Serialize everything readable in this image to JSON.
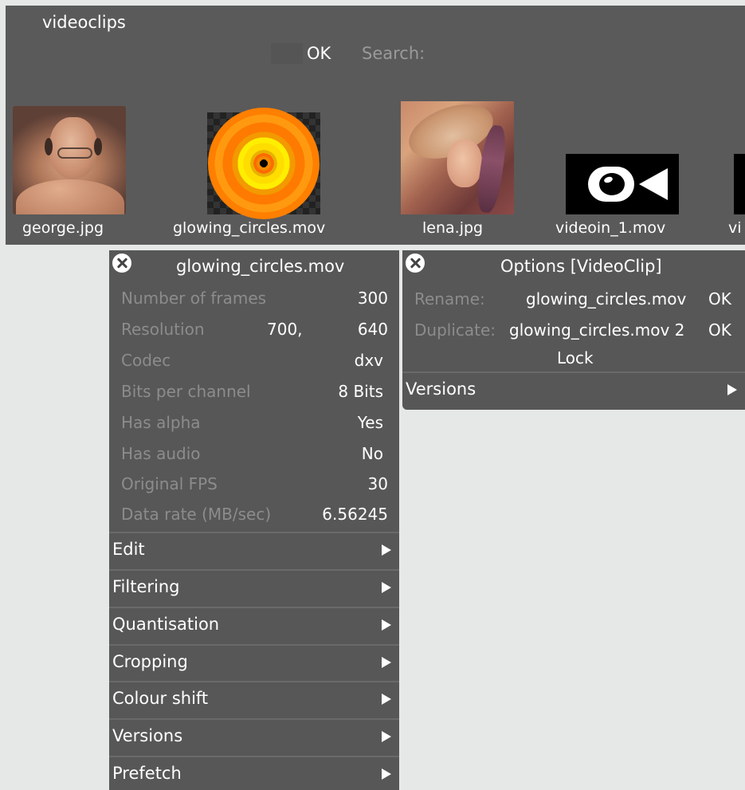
{
  "browser": {
    "title": "videoclips",
    "ok_label": "OK",
    "search_label": "Search:",
    "thumbnails": [
      {
        "label": "george.jpg"
      },
      {
        "label": "glowing_circles.mov"
      },
      {
        "label": "lena.jpg"
      },
      {
        "label": "videoin_1.mov"
      },
      {
        "label": "vi"
      }
    ]
  },
  "clip_panel": {
    "title": "glowing_circles.mov",
    "properties": [
      {
        "label": "Number of frames",
        "value": "300"
      },
      {
        "label": "Resolution",
        "value_a": "700,",
        "value": "640"
      },
      {
        "label": "Codec",
        "value": "dxv"
      },
      {
        "label": "Bits per channel",
        "value": "8 Bits"
      },
      {
        "label": "Has alpha",
        "value": "Yes"
      },
      {
        "label": "Has audio",
        "value": "No"
      },
      {
        "label": "Original FPS",
        "value": "30"
      },
      {
        "label": "Data rate (MB/sec)",
        "value": "6.56245"
      }
    ],
    "submenus": [
      {
        "label": "Edit"
      },
      {
        "label": "Filtering"
      },
      {
        "label": "Quantisation"
      },
      {
        "label": "Cropping"
      },
      {
        "label": "Colour shift"
      },
      {
        "label": "Versions"
      },
      {
        "label": "Prefetch"
      }
    ]
  },
  "options_panel": {
    "title": "Options [VideoClip]",
    "rename_label": "Rename:",
    "rename_value": "glowing_circles.mov",
    "rename_ok": "OK",
    "duplicate_label": "Duplicate:",
    "duplicate_value": "glowing_circles.mov 2",
    "duplicate_ok": "OK",
    "lock_label": "Lock",
    "versions_label": "Versions"
  }
}
